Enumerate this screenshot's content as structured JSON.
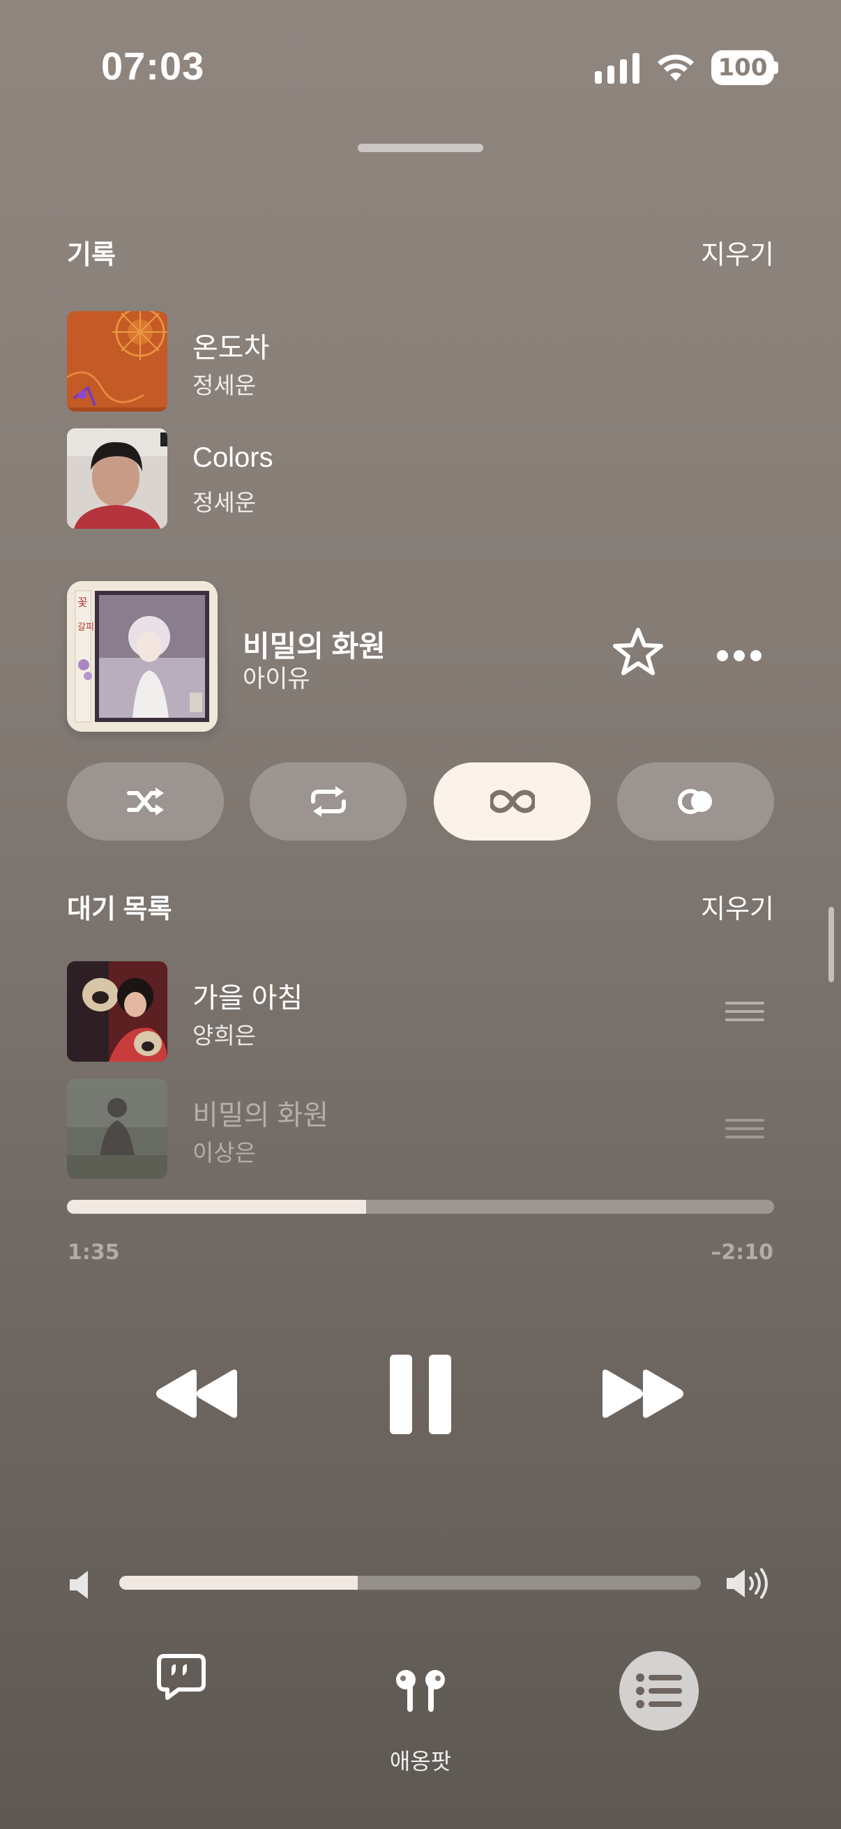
{
  "status_bar": {
    "time": "07:03",
    "battery": "100"
  },
  "history": {
    "title": "기록",
    "clear": "지우기",
    "items": [
      {
        "title": "온도차",
        "artist": "정세운"
      },
      {
        "title": "Colors",
        "artist": "정세운"
      }
    ]
  },
  "now_playing": {
    "title": "비밀의 화원",
    "artist": "아이유"
  },
  "modes": {
    "active": "infinity"
  },
  "queue": {
    "title": "대기 목록",
    "clear": "지우기",
    "items": [
      {
        "title": "가을 아침",
        "artist": "양희은"
      },
      {
        "title": "비밀의 화원",
        "artist": "이상은"
      }
    ]
  },
  "progress": {
    "elapsed": "1:35",
    "remaining": "–2:10",
    "fraction": 0.423
  },
  "volume": {
    "fraction": 0.41
  },
  "bottom_bar": {
    "airplay_label": "애옹팟"
  },
  "colors": {
    "accent": "#fbf2ea",
    "background_top": "#908680",
    "background_bottom": "#5e5853"
  },
  "icons": [
    "signal-icon",
    "wifi-icon",
    "star-icon",
    "shuffle-icon",
    "repeat-icon",
    "infinity-icon",
    "autoplay-icon",
    "rewind-icon",
    "pause-icon",
    "forward-icon",
    "speaker-low-icon",
    "speaker-high-icon",
    "lyrics-icon",
    "airpods-icon",
    "queue-list-icon"
  ]
}
